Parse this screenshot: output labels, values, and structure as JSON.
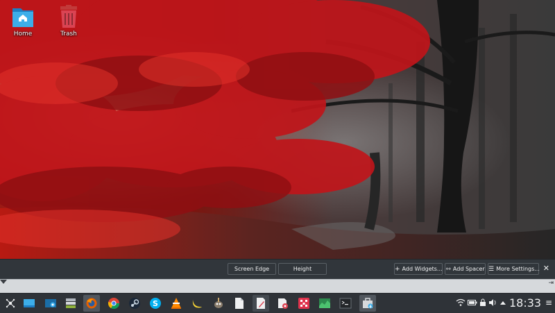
{
  "desktop": {
    "icons": [
      {
        "label": "Home",
        "icon": "home-folder-icon"
      },
      {
        "label": "Trash",
        "icon": "trash-icon"
      }
    ]
  },
  "panel_edit_toolbar": {
    "screen_edge_label": "Screen Edge",
    "height_label": "Height",
    "add_widgets_label": "Add Widgets...",
    "add_spacer_label": "Add Spacer",
    "more_settings_label": "More Settings...",
    "close_glyph": "✕"
  },
  "ruler": {
    "right_marker": "⇥"
  },
  "taskbar": {
    "launcher": "application-launcher-icon",
    "tasks": [
      "desktop-icon",
      "screenshot-folder-icon",
      "file-manager-icon",
      "firefox-icon",
      "chrome-icon",
      "steam-icon",
      "skype-icon",
      "vlc-icon",
      "banana-icon",
      "gimp-icon",
      "document-icon",
      "text-editor-icon",
      "media-viewer-icon",
      "red-app-icon",
      "system-monitor-icon",
      "terminal-icon",
      "package-installer-icon"
    ],
    "tray": [
      "wifi-icon",
      "battery-icon",
      "lock-icon",
      "volume-icon",
      "tray-expand-icon"
    ],
    "clock": "18:33",
    "menu_glyph": "≡"
  },
  "colors": {
    "panel_bg": "#2f3338",
    "toolbar_bg": "#31363b",
    "foliage_red": "#c0151a",
    "accent_blue": "#3daee9"
  }
}
